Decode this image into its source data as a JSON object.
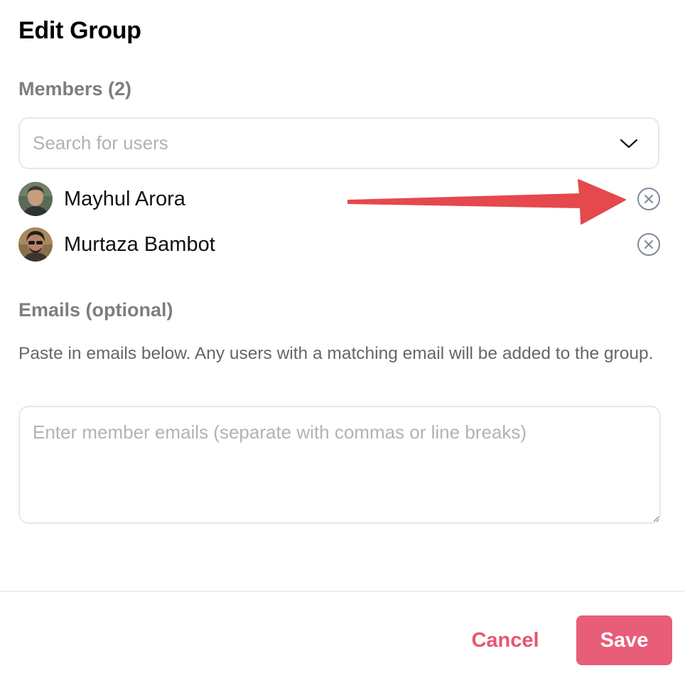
{
  "dialog": {
    "title": "Edit Group",
    "members_label": "Members (2)",
    "search": {
      "placeholder": "Search for users",
      "icon": "chevron-down-icon"
    },
    "members": [
      {
        "name": "Mayhul Arora",
        "avatar": "avatar-photo",
        "remove_icon": "remove-circle-x-icon"
      },
      {
        "name": "Murtaza Bambot",
        "avatar": "avatar-photo",
        "remove_icon": "remove-circle-x-icon"
      }
    ],
    "emails_label": "Emails (optional)",
    "emails_help": "Paste in emails below. Any users with a matching email will be added to the group.",
    "emails_placeholder": "Enter member emails (separate with commas or line breaks)",
    "cancel_label": "Cancel",
    "save_label": "Save"
  },
  "annotation": {
    "arrow_color": "#e5484d",
    "arrow_target": "remove-member-button"
  },
  "colors": {
    "accent": "#e85d78",
    "cancel_text": "#e8566f",
    "label_gray": "#7e7e7e",
    "border": "#e8e8e8"
  }
}
